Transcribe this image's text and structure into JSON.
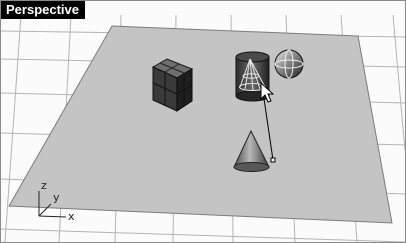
{
  "viewport": {
    "title": "Perspective",
    "background_color": "#fbfbfb",
    "grid_color": "#b4b4b4",
    "plane_color": "#c4c4c4"
  },
  "objects": [
    {
      "name": "box",
      "type": "box",
      "state": "normal"
    },
    {
      "name": "cylinder",
      "type": "cylinder",
      "state": "being-edited"
    },
    {
      "name": "sphere",
      "type": "sphere",
      "state": "normal"
    },
    {
      "name": "cone",
      "type": "cone",
      "state": "normal"
    }
  ],
  "axes": {
    "x": "x",
    "y": "y",
    "z": "z"
  },
  "cursor": {
    "icon": "arrow-cursor-icon"
  }
}
